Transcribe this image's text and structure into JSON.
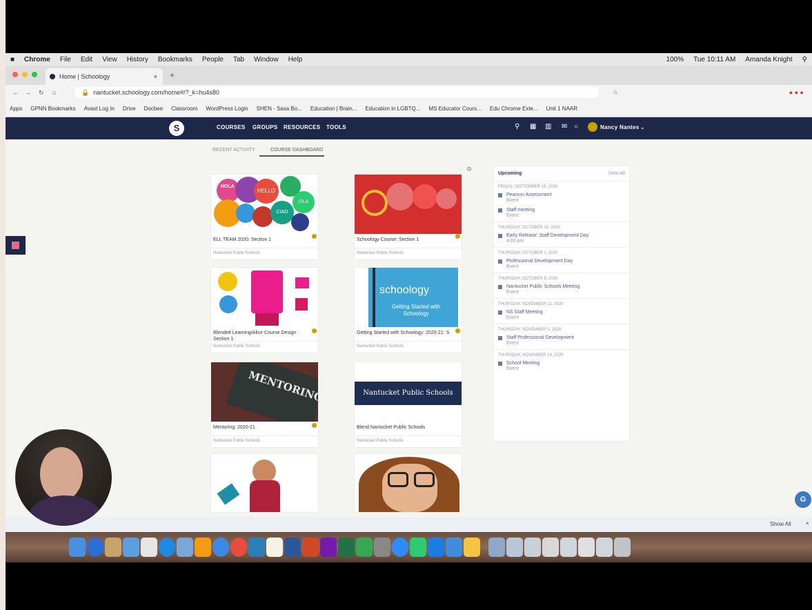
{
  "menubar": {
    "app": "Chrome",
    "items": [
      "File",
      "Edit",
      "View",
      "History",
      "Bookmarks",
      "People",
      "Tab",
      "Window",
      "Help"
    ],
    "battery": "100%",
    "clock": "Tue 10:11 AM",
    "user": "Amanda Knight"
  },
  "browser": {
    "tab_title": "Home | Schoology",
    "url": "nantucket.schoology.com/home#/?_k=hu4s80",
    "bookmarks": [
      "Apps",
      "GPNN Bookmarks",
      "Avast Log In",
      "Drive",
      "Docbee",
      "Classroom",
      "WordPress Login",
      "SHEN - Sasa Bo...",
      "Education | Brain...",
      "Education in LGBTQ...",
      "MS Educator Cours...",
      "Edu Chrome Exte...",
      "Unit 1 NAAR"
    ]
  },
  "header": {
    "nav": [
      "COURSES",
      "GROUPS",
      "RESOURCES",
      "TOOLS"
    ],
    "user_name": "Nancy Nantes"
  },
  "tabs": [
    "RECENT ACTIVITY",
    "COURSE DASHBOARD"
  ],
  "courses": [
    {
      "title": "ELL TEAM 2020: Section 1",
      "sub": "Nantucket Public Schools"
    },
    {
      "title": "Schoology Course: Section 1",
      "sub": "Nantucket Public Schools"
    },
    {
      "title": "Blended Learning/Alice Course Design : Section 1",
      "sub": "Nantucket Public Schools"
    },
    {
      "title": "Getting Started with Schoology: 2020-21: S",
      "sub": "Nantucket Public Schools"
    },
    {
      "title": "Mentoring: 2020-21",
      "sub": "Nantucket Public Schools"
    },
    {
      "title": "Blend Nantucket Public Schools",
      "sub": "Nantucket Public Schools"
    }
  ],
  "card_text": {
    "words": [
      "HOLA",
      "HELLO",
      "CIAO",
      "OLA",
      "HALLO",
      "BONJOUR"
    ],
    "schoology": "schoology",
    "getting_started": "Getting Started with Schoology",
    "mentoring": "MENTORING",
    "nps": "Nantucket Public Schools"
  },
  "upcoming": {
    "title": "Upcoming",
    "link": "View All",
    "groups": [
      {
        "date": "FRIDAY, SEPTEMBER 18, 2020",
        "items": [
          {
            "t": "Pearson Assessment",
            "s": "Event"
          },
          {
            "t": "Staff meeting",
            "s": "Event"
          }
        ]
      },
      {
        "date": "THURSDAY, OCTOBER 15, 2020",
        "items": [
          {
            "t": "Early Release: Staff Development Day",
            "s": "4:00 pm"
          }
        ]
      },
      {
        "date": "THURSDAY, OCTOBER 1, 2020",
        "items": [
          {
            "t": "Professional Development Day",
            "s": "Event"
          }
        ]
      },
      {
        "date": "THURSDAY, OCTOBER 8, 2020",
        "items": [
          {
            "t": "Nantucket Public Schools Meeting",
            "s": "Event"
          }
        ]
      },
      {
        "date": "THURSDAY, NOVEMBER 12, 2020",
        "items": [
          {
            "t": "NS Staff Meeting",
            "s": "Event"
          }
        ]
      },
      {
        "date": "THURSDAY, NOVEMBER 5, 2020",
        "items": [
          {
            "t": "Staff Professional Development",
            "s": "Event"
          }
        ]
      },
      {
        "date": "THURSDAY, NOVEMBER 19, 2020",
        "items": [
          {
            "t": "School Meeting",
            "s": "Event"
          }
        ]
      }
    ]
  },
  "download_bar": {
    "show_all": "Show All"
  },
  "fab": "G",
  "colors": {
    "header": "#1d2747",
    "accent": "#c5a300",
    "link": "#4a5c8e"
  }
}
